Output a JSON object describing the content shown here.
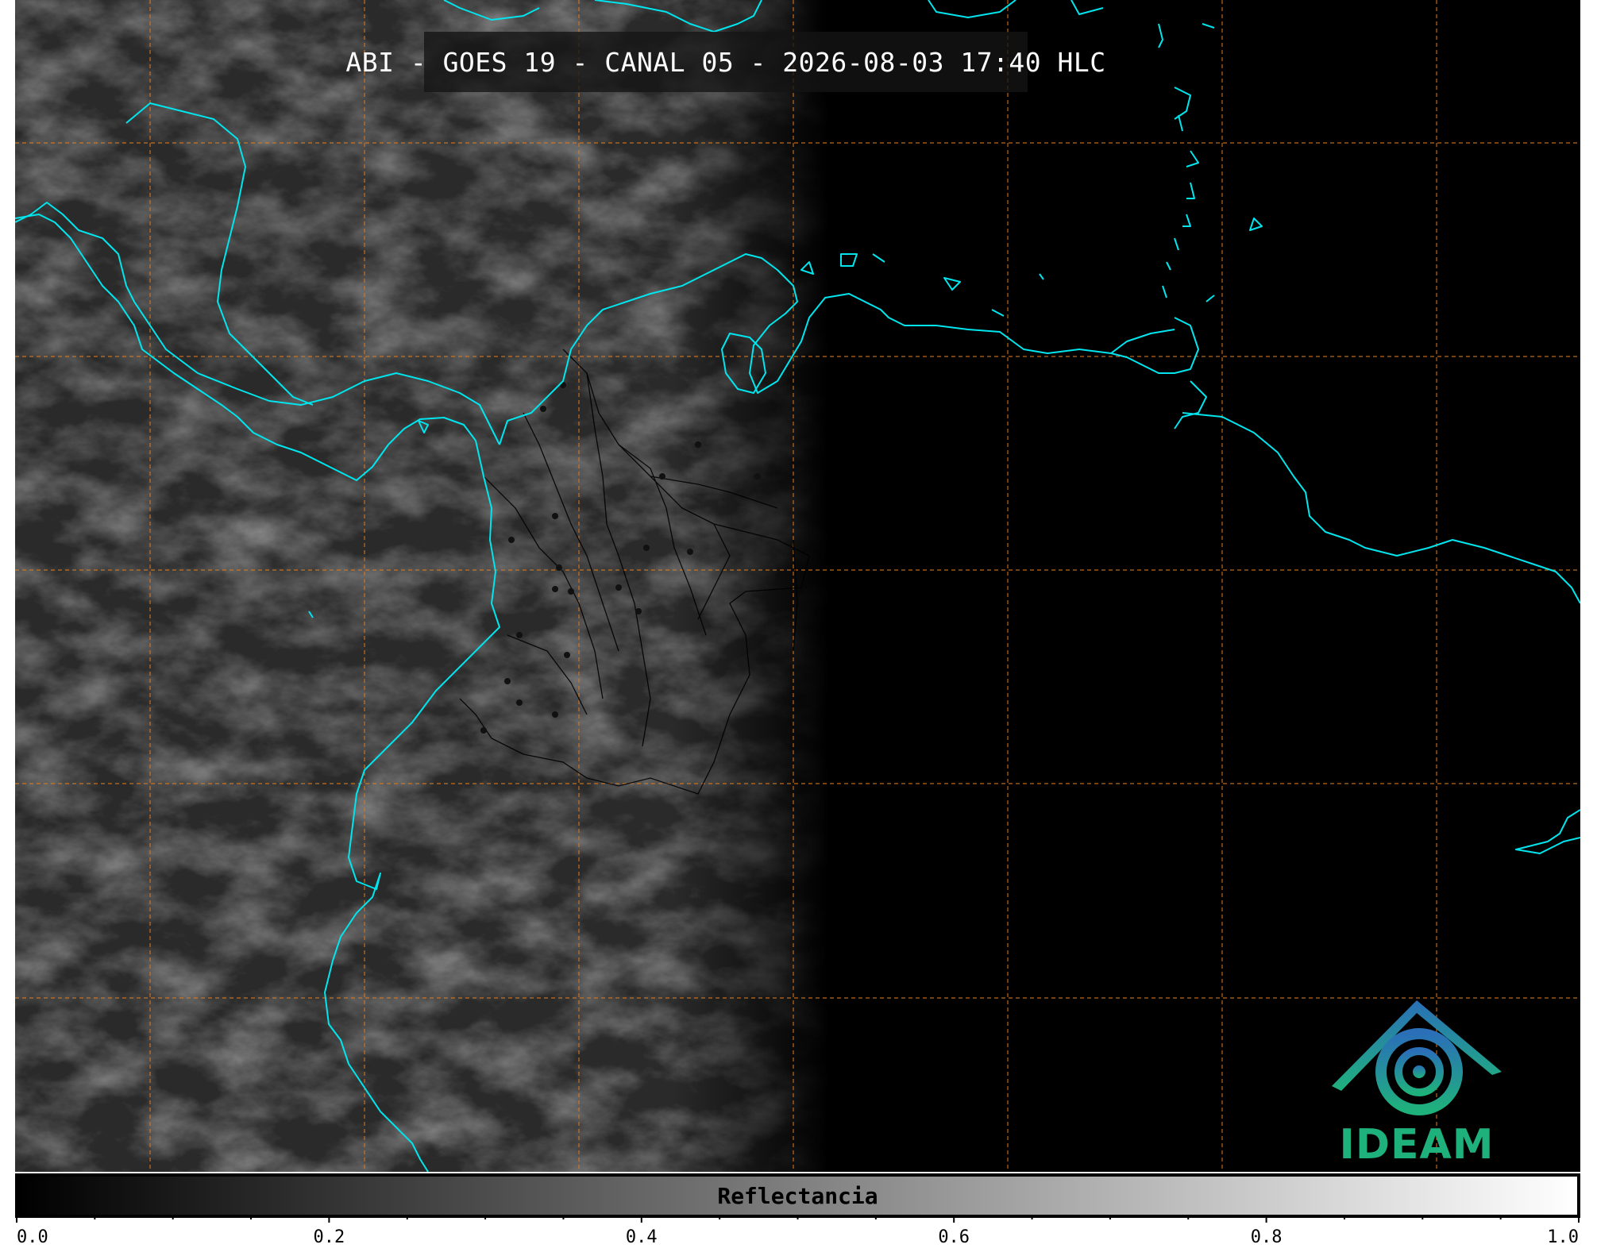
{
  "title": "ABI - GOES 19 - CANAL 05 - 2026-08-03 17:40 HLC",
  "logo_text": "IDEAM",
  "colorbar": {
    "label": "Reflectancia",
    "range": [
      0.0,
      1.0
    ],
    "major_ticks": [
      "0.0",
      "0.2",
      "0.4",
      "0.6",
      "0.8",
      "1.0"
    ],
    "minor_step": 0.05
  },
  "colors": {
    "coastline": "#00e5ee",
    "gridline": "#e07b1f",
    "borders": "#000000",
    "logo_green": "#1fb17c",
    "logo_blue": "#2a6fb8"
  }
}
